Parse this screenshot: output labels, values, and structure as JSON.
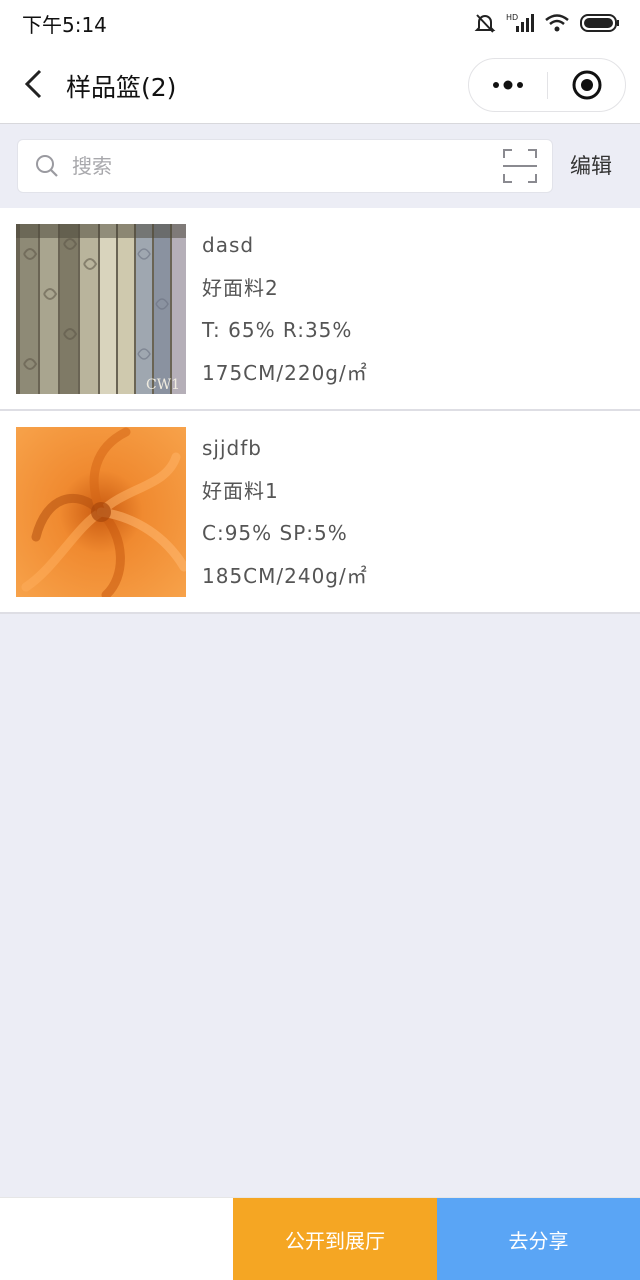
{
  "status_bar": {
    "time": "下午5:14",
    "network_label": "HD"
  },
  "nav": {
    "title": "样品篮(2)"
  },
  "search": {
    "placeholder": "搜索",
    "value": ""
  },
  "toolbar": {
    "edit_label": "编辑"
  },
  "items": [
    {
      "code": "dasd",
      "name": "好面料2",
      "composition": "T: 65% R:35%",
      "spec": "175CM/220g/㎡",
      "thumb_watermark": "CW1"
    },
    {
      "code": "sjjdfb",
      "name": "好面料1",
      "composition": "C:95% SP:5%",
      "spec": "185CM/240g/㎡"
    }
  ],
  "actions": {
    "publish_label": "公开到展厅",
    "share_label": "去分享"
  },
  "colors": {
    "publish_bg": "#f5a623",
    "share_bg": "#5aa5f5",
    "page_bg": "#ecedf5"
  }
}
